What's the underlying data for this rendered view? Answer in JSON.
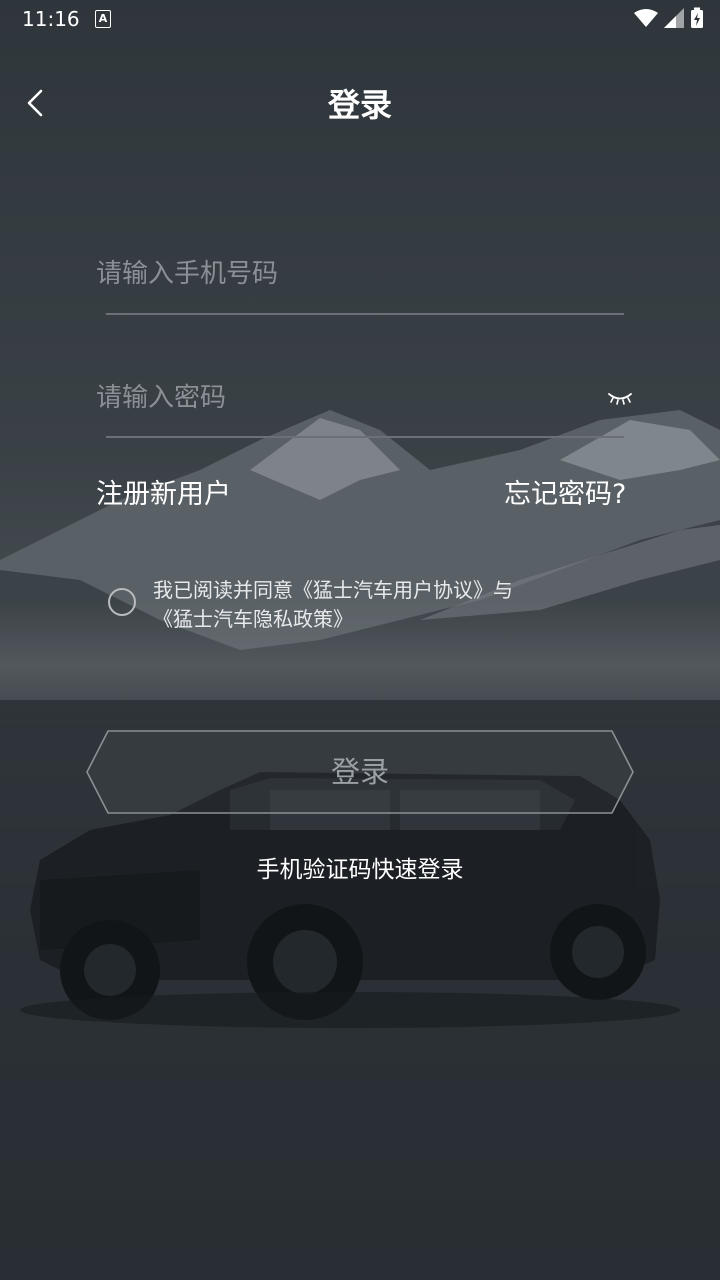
{
  "status_bar": {
    "time": "11:16",
    "badge": "A",
    "icons": [
      "wifi-icon",
      "signal-icon",
      "battery-charging-icon"
    ]
  },
  "header": {
    "title": "登录",
    "back_icon": "chevron-left-icon"
  },
  "form": {
    "phone_placeholder": "请输入手机号码",
    "password_placeholder": "请输入密码",
    "toggle_icon": "eye-closed-icon",
    "register_label": "注册新用户",
    "forgot_label": "忘记密码?",
    "agreement_line1": "我已阅读并同意《猛士汽车用户协议》与",
    "agreement_line2": "《猛士汽车隐私政策》",
    "agreement_checked": false,
    "login_label": "登录",
    "sms_login_label": "手机验证码快速登录"
  },
  "colors": {
    "background": "#2b3136",
    "placeholder": "#8b9096",
    "underline": "#6a7076",
    "button_text": "#9aa0a6"
  }
}
